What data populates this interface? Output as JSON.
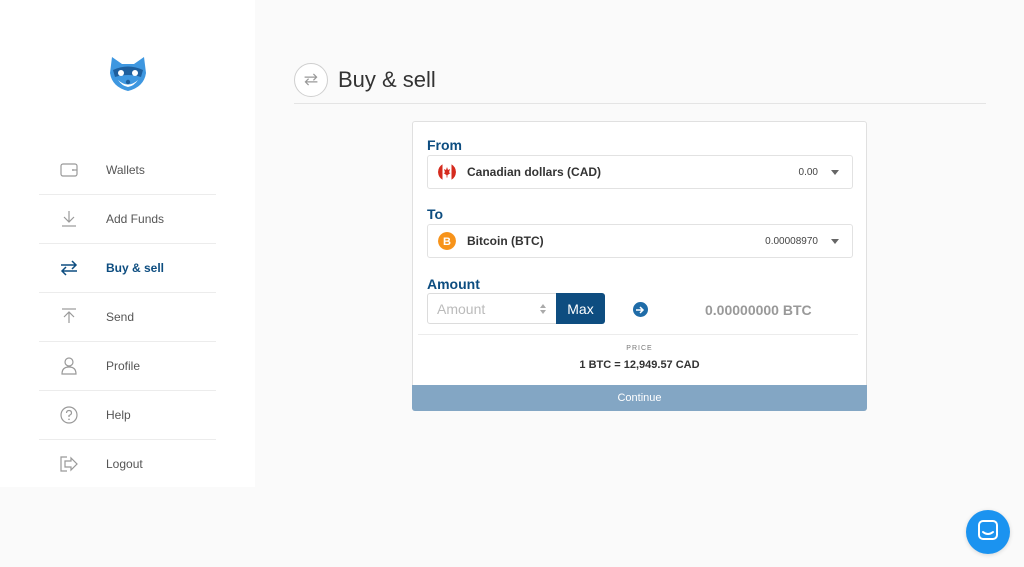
{
  "nav": {
    "items": [
      {
        "label": "Wallets",
        "icon": "wallet-icon"
      },
      {
        "label": "Add Funds",
        "icon": "download-icon"
      },
      {
        "label": "Buy & sell",
        "icon": "exchange-icon",
        "active": true
      },
      {
        "label": "Send",
        "icon": "upload-icon"
      },
      {
        "label": "Profile",
        "icon": "user-icon"
      },
      {
        "label": "Help",
        "icon": "help-icon"
      },
      {
        "label": "Logout",
        "icon": "logout-icon"
      }
    ]
  },
  "header": {
    "title": "Buy & sell",
    "icon": "exchange-icon"
  },
  "form": {
    "from_label": "From",
    "from": {
      "name": "Canadian dollars (CAD)",
      "balance": "0.00",
      "icon": "canada-flag-icon"
    },
    "to_label": "To",
    "to": {
      "name": "Bitcoin (BTC)",
      "balance": "0.00008970",
      "icon": "bitcoin-icon"
    },
    "amount_label": "Amount",
    "amount_placeholder": "Amount",
    "amount_value": "",
    "max_label": "Max",
    "converted": "0.00000000 BTC",
    "price_label": "PRICE",
    "price_value": "1 BTC = 12,949.57 CAD",
    "continue_label": "Continue"
  },
  "colors": {
    "brand": "#0e4d80",
    "accent": "#1b93f0",
    "continue_disabled": "#83a6c4",
    "bitcoin": "#f7931a",
    "canada_red": "#d52b1e"
  }
}
